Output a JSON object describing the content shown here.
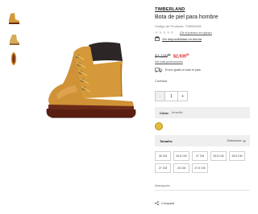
{
  "product": {
    "brand": "TIMBERLAND",
    "title": "Bota de piel para hombre",
    "code": "Código de Producto: 718661046",
    "rating_stars": "★★★★★",
    "review_link": "(Sé el primero en opinar)",
    "store_link": "Ver disponibilidad en tienda"
  },
  "price": {
    "old_int": "$4,199",
    "old_dec": "00",
    "new_int": "$2,939",
    "new_dec": "30",
    "discount_link": "Ver más promociones"
  },
  "shipping": {
    "text": "Envío gratis a toda el país"
  },
  "quantity": {
    "label": "Cantidad",
    "minus": "-",
    "value": "1",
    "plus": "+"
  },
  "color": {
    "label": "Color:",
    "value": "Amarillo",
    "swatch": "#e5bb3c"
  },
  "size": {
    "label": "Tamaño:",
    "select_label": "Selecciona",
    "options": [
      "26 CM",
      "26.5 CM",
      "27 CM",
      "26.5 CM",
      "28.5 CM",
      "27 CM",
      "26 CM",
      "27.5 CM"
    ]
  },
  "description": {
    "label": "Descripción"
  },
  "share": {
    "label": "Compartir"
  },
  "colors": {
    "accent_red": "#e02020",
    "boot": "#d39a3a",
    "sole": "#7a2a18"
  }
}
